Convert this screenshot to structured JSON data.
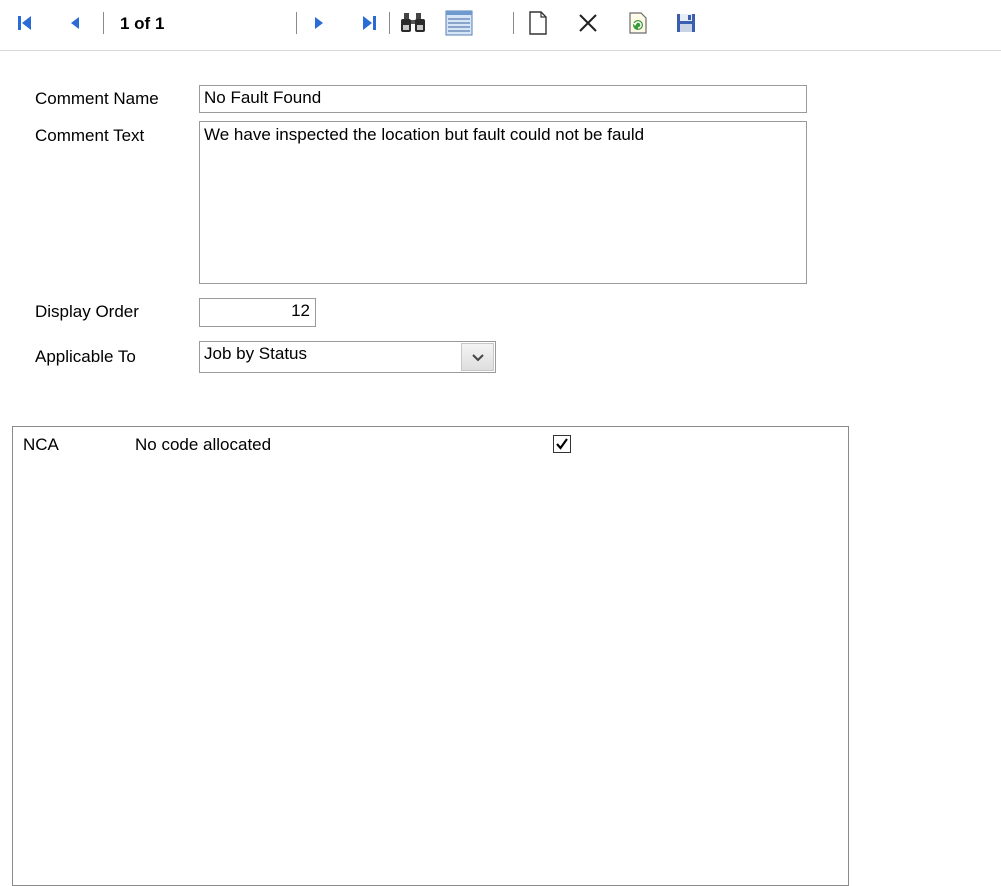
{
  "toolbar": {
    "page_indicator": "1 of 1",
    "icons": [
      "first-record-icon",
      "previous-record-icon",
      "next-record-icon",
      "last-record-icon",
      "find-icon",
      "list-view-icon",
      "new-record-icon",
      "delete-icon",
      "refresh-icon",
      "save-icon"
    ],
    "accent_color": "#2b6bd6"
  },
  "form": {
    "comment_name_label": "Comment Name",
    "comment_name_value": "No Fault Found",
    "comment_text_label": "Comment Text",
    "comment_text_value": "We have inspected the location but fault could not be fauld",
    "display_order_label": "Display Order",
    "display_order_value": "12",
    "applicable_to_label": "Applicable To",
    "applicable_to_value": "Job by Status"
  },
  "list": {
    "rows": [
      {
        "code": "NCA",
        "description": "No code allocated",
        "checked": true
      }
    ]
  }
}
